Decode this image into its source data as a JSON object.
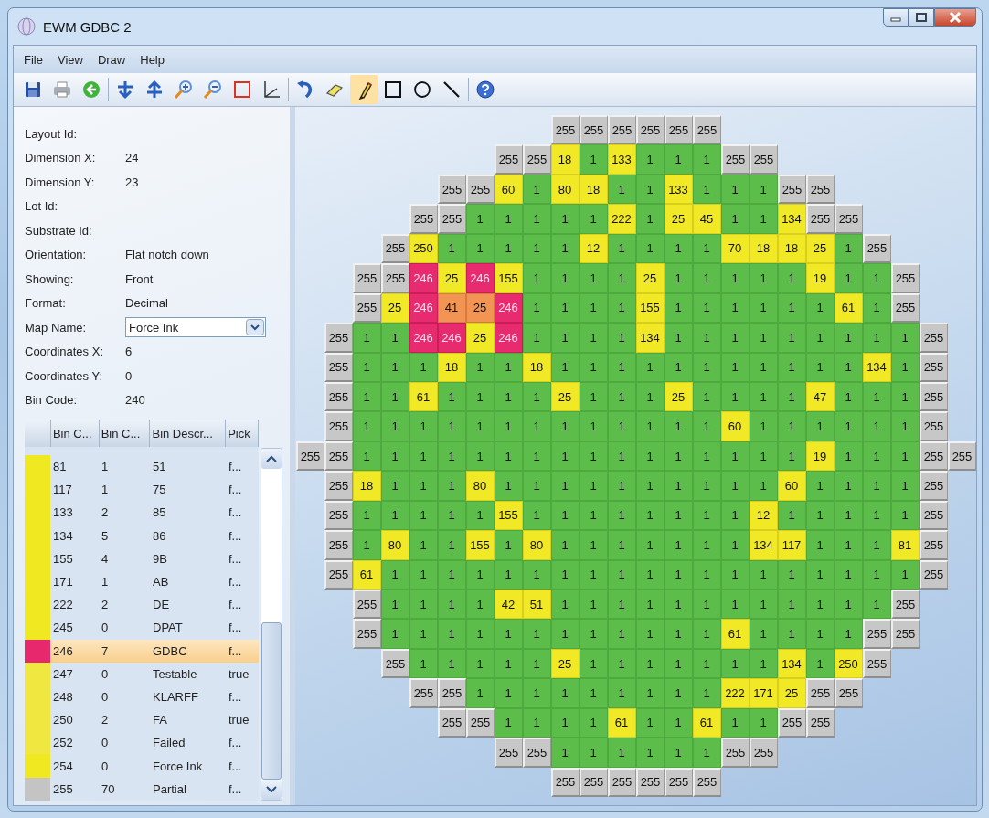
{
  "window": {
    "title": "EWM GDBC 2"
  },
  "menu": [
    "File",
    "View",
    "Draw",
    "Help"
  ],
  "toolbar": [
    {
      "kind": "save",
      "selected": false
    },
    {
      "kind": "print",
      "selected": false
    },
    {
      "kind": "back",
      "selected": false
    },
    {
      "kind": "separator"
    },
    {
      "kind": "flip-down",
      "selected": false
    },
    {
      "kind": "flip-up",
      "selected": false
    },
    {
      "kind": "zoom-in",
      "selected": false
    },
    {
      "kind": "zoom-out",
      "selected": false
    },
    {
      "kind": "frame",
      "selected": false
    },
    {
      "kind": "axes",
      "selected": false
    },
    {
      "kind": "separator"
    },
    {
      "kind": "undo",
      "selected": false
    },
    {
      "kind": "eraser",
      "selected": false
    },
    {
      "kind": "pencil",
      "selected": true
    },
    {
      "kind": "rectangle",
      "selected": false
    },
    {
      "kind": "circle",
      "selected": false
    },
    {
      "kind": "line",
      "selected": false
    },
    {
      "kind": "separator"
    },
    {
      "kind": "help",
      "selected": false
    }
  ],
  "properties": [
    {
      "kind": "text",
      "label": "Layout Id:"
    },
    {
      "kind": "text",
      "label": "Dimension X:",
      "value": "24"
    },
    {
      "kind": "text",
      "label": "Dimension Y:",
      "value": "23"
    },
    {
      "kind": "text",
      "label": "Lot Id:"
    },
    {
      "kind": "text",
      "label": "Substrate Id:"
    },
    {
      "kind": "text",
      "label": "Orientation:",
      "value": "Flat notch down"
    },
    {
      "kind": "text",
      "label": "Showing:",
      "value": "Front"
    },
    {
      "kind": "text",
      "label": "Format:",
      "value": "Decimal"
    },
    {
      "kind": "combo",
      "label": "Map Name:",
      "value": "Force Ink"
    },
    {
      "kind": "text",
      "label": "Coordinates X:",
      "value": "6"
    },
    {
      "kind": "text",
      "label": "Coordinates Y:",
      "value": "0"
    },
    {
      "kind": "text",
      "label": "Bin Code:",
      "value": "240"
    }
  ],
  "bin_table": {
    "columns": [
      "Bin C...",
      "Bin C...",
      "Bin Descr...",
      "Pick"
    ],
    "rows": [
      {
        "color": "#f0e820",
        "cells": [
          "81",
          "1",
          "51",
          "f..."
        ],
        "selected": false
      },
      {
        "color": "#f0e820",
        "cells": [
          "117",
          "1",
          "75",
          "f..."
        ],
        "selected": false
      },
      {
        "color": "#f0e820",
        "cells": [
          "133",
          "2",
          "85",
          "f..."
        ],
        "selected": false
      },
      {
        "color": "#f0e820",
        "cells": [
          "134",
          "5",
          "86",
          "f..."
        ],
        "selected": false
      },
      {
        "color": "#f0e820",
        "cells": [
          "155",
          "4",
          "9B",
          "f..."
        ],
        "selected": false
      },
      {
        "color": "#f0e820",
        "cells": [
          "171",
          "1",
          "AB",
          "f..."
        ],
        "selected": false
      },
      {
        "color": "#f0e820",
        "cells": [
          "222",
          "2",
          "DE",
          "f..."
        ],
        "selected": false
      },
      {
        "color": "#f0e820",
        "cells": [
          "245",
          "0",
          "DPAT",
          "f..."
        ],
        "selected": false
      },
      {
        "color": "#e8286c",
        "cells": [
          "246",
          "7",
          "GDBC",
          "f..."
        ],
        "selected": true
      },
      {
        "color": "#f0e840",
        "cells": [
          "247",
          "0",
          "Testable",
          "true"
        ],
        "selected": false
      },
      {
        "color": "#f0e840",
        "cells": [
          "248",
          "0",
          "KLARFF",
          "f..."
        ],
        "selected": false
      },
      {
        "color": "#f0e840",
        "cells": [
          "250",
          "2",
          "FA",
          "true"
        ],
        "selected": false
      },
      {
        "color": "#f0e840",
        "cells": [
          "252",
          "0",
          "Failed",
          "f..."
        ],
        "selected": false
      },
      {
        "color": "#f0e820",
        "cells": [
          "254",
          "0",
          "Force Ink",
          "f..."
        ],
        "selected": false
      },
      {
        "color": "#c4c4c4",
        "cells": [
          "255",
          "70",
          "Partial",
          "f..."
        ],
        "selected": false
      }
    ]
  },
  "wafer_map": {
    "rows": [
      [
        null,
        null,
        null,
        null,
        null,
        null,
        null,
        null,
        null,
        {
          "bin": "255",
          "kind": "edge"
        },
        {
          "bin": "255",
          "kind": "edge"
        },
        {
          "bin": "255",
          "kind": "edge"
        },
        {
          "bin": "255",
          "kind": "edge"
        },
        {
          "bin": "255",
          "kind": "edge"
        },
        {
          "bin": "255",
          "kind": "edge"
        },
        null,
        null,
        null,
        null,
        null,
        null,
        null,
        null,
        null
      ],
      [
        null,
        null,
        null,
        null,
        null,
        null,
        null,
        {
          "bin": "255",
          "kind": "edge"
        },
        {
          "bin": "255",
          "kind": "edge"
        },
        {
          "bin": "18",
          "kind": "fail"
        },
        {
          "bin": "1",
          "kind": "pass"
        },
        {
          "bin": "133",
          "kind": "fail"
        },
        {
          "bin": "1",
          "kind": "pass"
        },
        {
          "bin": "1",
          "kind": "pass"
        },
        {
          "bin": "1",
          "kind": "pass"
        },
        {
          "bin": "255",
          "kind": "edge"
        },
        {
          "bin": "255",
          "kind": "edge"
        },
        null,
        null,
        null,
        null,
        null,
        null,
        null
      ],
      [
        null,
        null,
        null,
        null,
        null,
        {
          "bin": "255",
          "kind": "edge"
        },
        {
          "bin": "255",
          "kind": "edge"
        },
        {
          "bin": "60",
          "kind": "fail"
        },
        {
          "bin": "1",
          "kind": "pass"
        },
        {
          "bin": "80",
          "kind": "fail"
        },
        {
          "bin": "18",
          "kind": "fail"
        },
        {
          "bin": "1",
          "kind": "pass"
        },
        {
          "bin": "1",
          "kind": "pass"
        },
        {
          "bin": "133",
          "kind": "fail"
        },
        {
          "bin": "1",
          "kind": "pass"
        },
        {
          "bin": "1",
          "kind": "pass"
        },
        {
          "bin": "1",
          "kind": "pass"
        },
        {
          "bin": "255",
          "kind": "edge"
        },
        {
          "bin": "255",
          "kind": "edge"
        },
        null,
        null,
        null,
        null,
        null
      ],
      [
        null,
        null,
        null,
        null,
        {
          "bin": "255",
          "kind": "edge"
        },
        {
          "bin": "255",
          "kind": "edge"
        },
        {
          "bin": "1",
          "kind": "pass"
        },
        {
          "bin": "1",
          "kind": "pass"
        },
        {
          "bin": "1",
          "kind": "pass"
        },
        {
          "bin": "1",
          "kind": "pass"
        },
        {
          "bin": "1",
          "kind": "pass"
        },
        {
          "bin": "222",
          "kind": "fail"
        },
        {
          "bin": "1",
          "kind": "pass"
        },
        {
          "bin": "25",
          "kind": "fail"
        },
        {
          "bin": "45",
          "kind": "fail"
        },
        {
          "bin": "1",
          "kind": "pass"
        },
        {
          "bin": "1",
          "kind": "pass"
        },
        {
          "bin": "134",
          "kind": "fail"
        },
        {
          "bin": "255",
          "kind": "edge"
        },
        {
          "bin": "255",
          "kind": "edge"
        },
        null,
        null,
        null,
        null
      ],
      [
        null,
        null,
        null,
        {
          "bin": "255",
          "kind": "edge"
        },
        {
          "bin": "250",
          "kind": "fail"
        },
        {
          "bin": "1",
          "kind": "pass"
        },
        {
          "bin": "1",
          "kind": "pass"
        },
        {
          "bin": "1",
          "kind": "pass"
        },
        {
          "bin": "1",
          "kind": "pass"
        },
        {
          "bin": "1",
          "kind": "pass"
        },
        {
          "bin": "12",
          "kind": "fail"
        },
        {
          "bin": "1",
          "kind": "pass"
        },
        {
          "bin": "1",
          "kind": "pass"
        },
        {
          "bin": "1",
          "kind": "pass"
        },
        {
          "bin": "1",
          "kind": "pass"
        },
        {
          "bin": "70",
          "kind": "fail"
        },
        {
          "bin": "18",
          "kind": "fail"
        },
        {
          "bin": "18",
          "kind": "fail"
        },
        {
          "bin": "25",
          "kind": "fail"
        },
        {
          "bin": "1",
          "kind": "pass"
        },
        {
          "bin": "255",
          "kind": "edge"
        },
        null,
        null,
        null
      ],
      [
        null,
        null,
        {
          "bin": "255",
          "kind": "edge"
        },
        {
          "bin": "255",
          "kind": "edge"
        },
        {
          "bin": "246",
          "kind": "gdbc"
        },
        {
          "bin": "25",
          "kind": "fail"
        },
        {
          "bin": "246",
          "kind": "gdbc"
        },
        {
          "bin": "155",
          "kind": "fail"
        },
        {
          "bin": "1",
          "kind": "pass"
        },
        {
          "bin": "1",
          "kind": "pass"
        },
        {
          "bin": "1",
          "kind": "pass"
        },
        {
          "bin": "1",
          "kind": "pass"
        },
        {
          "bin": "25",
          "kind": "fail"
        },
        {
          "bin": "1",
          "kind": "pass"
        },
        {
          "bin": "1",
          "kind": "pass"
        },
        {
          "bin": "1",
          "kind": "pass"
        },
        {
          "bin": "1",
          "kind": "pass"
        },
        {
          "bin": "1",
          "kind": "pass"
        },
        {
          "bin": "19",
          "kind": "fail"
        },
        {
          "bin": "1",
          "kind": "pass"
        },
        {
          "bin": "1",
          "kind": "pass"
        },
        {
          "bin": "255",
          "kind": "edge"
        },
        null,
        null
      ],
      [
        null,
        null,
        {
          "bin": "255",
          "kind": "edge"
        },
        {
          "bin": "25",
          "kind": "fail"
        },
        {
          "bin": "246",
          "kind": "gdbc"
        },
        {
          "bin": "41",
          "kind": "near"
        },
        {
          "bin": "25",
          "kind": "near"
        },
        {
          "bin": "246",
          "kind": "gdbc"
        },
        {
          "bin": "1",
          "kind": "pass"
        },
        {
          "bin": "1",
          "kind": "pass"
        },
        {
          "bin": "1",
          "kind": "pass"
        },
        {
          "bin": "1",
          "kind": "pass"
        },
        {
          "bin": "155",
          "kind": "fail"
        },
        {
          "bin": "1",
          "kind": "pass"
        },
        {
          "bin": "1",
          "kind": "pass"
        },
        {
          "bin": "1",
          "kind": "pass"
        },
        {
          "bin": "1",
          "kind": "pass"
        },
        {
          "bin": "1",
          "kind": "pass"
        },
        {
          "bin": "1",
          "kind": "pass"
        },
        {
          "bin": "61",
          "kind": "fail"
        },
        {
          "bin": "1",
          "kind": "pass"
        },
        {
          "bin": "255",
          "kind": "edge"
        },
        null,
        null
      ],
      [
        null,
        {
          "bin": "255",
          "kind": "edge"
        },
        {
          "bin": "1",
          "kind": "pass"
        },
        {
          "bin": "1",
          "kind": "pass"
        },
        {
          "bin": "246",
          "kind": "gdbc"
        },
        {
          "bin": "246",
          "kind": "gdbc"
        },
        {
          "bin": "25",
          "kind": "fail"
        },
        {
          "bin": "246",
          "kind": "gdbc"
        },
        {
          "bin": "1",
          "kind": "pass"
        },
        {
          "bin": "1",
          "kind": "pass"
        },
        {
          "bin": "1",
          "kind": "pass"
        },
        {
          "bin": "1",
          "kind": "pass"
        },
        {
          "bin": "134",
          "kind": "fail"
        },
        {
          "bin": "1",
          "kind": "pass"
        },
        {
          "bin": "1",
          "kind": "pass"
        },
        {
          "bin": "1",
          "kind": "pass"
        },
        {
          "bin": "1",
          "kind": "pass"
        },
        {
          "bin": "1",
          "kind": "pass"
        },
        {
          "bin": "1",
          "kind": "pass"
        },
        {
          "bin": "1",
          "kind": "pass"
        },
        {
          "bin": "1",
          "kind": "pass"
        },
        {
          "bin": "1",
          "kind": "pass"
        },
        {
          "bin": "255",
          "kind": "edge"
        },
        null
      ],
      [
        null,
        {
          "bin": "255",
          "kind": "edge"
        },
        {
          "bin": "1",
          "kind": "pass"
        },
        {
          "bin": "1",
          "kind": "pass"
        },
        {
          "bin": "1",
          "kind": "pass"
        },
        {
          "bin": "18",
          "kind": "fail"
        },
        {
          "bin": "1",
          "kind": "pass"
        },
        {
          "bin": "1",
          "kind": "pass"
        },
        {
          "bin": "18",
          "kind": "fail"
        },
        {
          "bin": "1",
          "kind": "pass"
        },
        {
          "bin": "1",
          "kind": "pass"
        },
        {
          "bin": "1",
          "kind": "pass"
        },
        {
          "bin": "1",
          "kind": "pass"
        },
        {
          "bin": "1",
          "kind": "pass"
        },
        {
          "bin": "1",
          "kind": "pass"
        },
        {
          "bin": "1",
          "kind": "pass"
        },
        {
          "bin": "1",
          "kind": "pass"
        },
        {
          "bin": "1",
          "kind": "pass"
        },
        {
          "bin": "1",
          "kind": "pass"
        },
        {
          "bin": "1",
          "kind": "pass"
        },
        {
          "bin": "134",
          "kind": "fail"
        },
        {
          "bin": "1",
          "kind": "pass"
        },
        {
          "bin": "255",
          "kind": "edge"
        },
        null
      ],
      [
        null,
        {
          "bin": "255",
          "kind": "edge"
        },
        {
          "bin": "1",
          "kind": "pass"
        },
        {
          "bin": "1",
          "kind": "pass"
        },
        {
          "bin": "61",
          "kind": "fail"
        },
        {
          "bin": "1",
          "kind": "pass"
        },
        {
          "bin": "1",
          "kind": "pass"
        },
        {
          "bin": "1",
          "kind": "pass"
        },
        {
          "bin": "1",
          "kind": "pass"
        },
        {
          "bin": "25",
          "kind": "fail"
        },
        {
          "bin": "1",
          "kind": "pass"
        },
        {
          "bin": "1",
          "kind": "pass"
        },
        {
          "bin": "1",
          "kind": "pass"
        },
        {
          "bin": "25",
          "kind": "fail"
        },
        {
          "bin": "1",
          "kind": "pass"
        },
        {
          "bin": "1",
          "kind": "pass"
        },
        {
          "bin": "1",
          "kind": "pass"
        },
        {
          "bin": "1",
          "kind": "pass"
        },
        {
          "bin": "47",
          "kind": "fail"
        },
        {
          "bin": "1",
          "kind": "pass"
        },
        {
          "bin": "1",
          "kind": "pass"
        },
        {
          "bin": "1",
          "kind": "pass"
        },
        {
          "bin": "255",
          "kind": "edge"
        },
        null
      ],
      [
        null,
        {
          "bin": "255",
          "kind": "edge"
        },
        {
          "bin": "1",
          "kind": "pass"
        },
        {
          "bin": "1",
          "kind": "pass"
        },
        {
          "bin": "1",
          "kind": "pass"
        },
        {
          "bin": "1",
          "kind": "pass"
        },
        {
          "bin": "1",
          "kind": "pass"
        },
        {
          "bin": "1",
          "kind": "pass"
        },
        {
          "bin": "1",
          "kind": "pass"
        },
        {
          "bin": "1",
          "kind": "pass"
        },
        {
          "bin": "1",
          "kind": "pass"
        },
        {
          "bin": "1",
          "kind": "pass"
        },
        {
          "bin": "1",
          "kind": "pass"
        },
        {
          "bin": "1",
          "kind": "pass"
        },
        {
          "bin": "1",
          "kind": "pass"
        },
        {
          "bin": "60",
          "kind": "fail"
        },
        {
          "bin": "1",
          "kind": "pass"
        },
        {
          "bin": "1",
          "kind": "pass"
        },
        {
          "bin": "1",
          "kind": "pass"
        },
        {
          "bin": "1",
          "kind": "pass"
        },
        {
          "bin": "1",
          "kind": "pass"
        },
        {
          "bin": "1",
          "kind": "pass"
        },
        {
          "bin": "255",
          "kind": "edge"
        },
        null
      ],
      [
        {
          "bin": "255",
          "kind": "edge"
        },
        {
          "bin": "255",
          "kind": "edge"
        },
        {
          "bin": "1",
          "kind": "pass"
        },
        {
          "bin": "1",
          "kind": "pass"
        },
        {
          "bin": "1",
          "kind": "pass"
        },
        {
          "bin": "1",
          "kind": "pass"
        },
        {
          "bin": "1",
          "kind": "pass"
        },
        {
          "bin": "1",
          "kind": "pass"
        },
        {
          "bin": "1",
          "kind": "pass"
        },
        {
          "bin": "1",
          "kind": "pass"
        },
        {
          "bin": "1",
          "kind": "pass"
        },
        {
          "bin": "1",
          "kind": "pass"
        },
        {
          "bin": "1",
          "kind": "pass"
        },
        {
          "bin": "1",
          "kind": "pass"
        },
        {
          "bin": "1",
          "kind": "pass"
        },
        {
          "bin": "1",
          "kind": "pass"
        },
        {
          "bin": "1",
          "kind": "pass"
        },
        {
          "bin": "1",
          "kind": "pass"
        },
        {
          "bin": "19",
          "kind": "fail"
        },
        {
          "bin": "1",
          "kind": "pass"
        },
        {
          "bin": "1",
          "kind": "pass"
        },
        {
          "bin": "1",
          "kind": "pass"
        },
        {
          "bin": "255",
          "kind": "edge"
        },
        {
          "bin": "255",
          "kind": "edge"
        }
      ],
      [
        null,
        {
          "bin": "255",
          "kind": "edge"
        },
        {
          "bin": "18",
          "kind": "fail"
        },
        {
          "bin": "1",
          "kind": "pass"
        },
        {
          "bin": "1",
          "kind": "pass"
        },
        {
          "bin": "1",
          "kind": "pass"
        },
        {
          "bin": "80",
          "kind": "fail"
        },
        {
          "bin": "1",
          "kind": "pass"
        },
        {
          "bin": "1",
          "kind": "pass"
        },
        {
          "bin": "1",
          "kind": "pass"
        },
        {
          "bin": "1",
          "kind": "pass"
        },
        {
          "bin": "1",
          "kind": "pass"
        },
        {
          "bin": "1",
          "kind": "pass"
        },
        {
          "bin": "1",
          "kind": "pass"
        },
        {
          "bin": "1",
          "kind": "pass"
        },
        {
          "bin": "1",
          "kind": "pass"
        },
        {
          "bin": "1",
          "kind": "pass"
        },
        {
          "bin": "60",
          "kind": "fail"
        },
        {
          "bin": "1",
          "kind": "pass"
        },
        {
          "bin": "1",
          "kind": "pass"
        },
        {
          "bin": "1",
          "kind": "pass"
        },
        {
          "bin": "1",
          "kind": "pass"
        },
        {
          "bin": "255",
          "kind": "edge"
        },
        null
      ],
      [
        null,
        {
          "bin": "255",
          "kind": "edge"
        },
        {
          "bin": "1",
          "kind": "pass"
        },
        {
          "bin": "1",
          "kind": "pass"
        },
        {
          "bin": "1",
          "kind": "pass"
        },
        {
          "bin": "1",
          "kind": "pass"
        },
        {
          "bin": "1",
          "kind": "pass"
        },
        {
          "bin": "155",
          "kind": "fail"
        },
        {
          "bin": "1",
          "kind": "pass"
        },
        {
          "bin": "1",
          "kind": "pass"
        },
        {
          "bin": "1",
          "kind": "pass"
        },
        {
          "bin": "1",
          "kind": "pass"
        },
        {
          "bin": "1",
          "kind": "pass"
        },
        {
          "bin": "1",
          "kind": "pass"
        },
        {
          "bin": "1",
          "kind": "pass"
        },
        {
          "bin": "1",
          "kind": "pass"
        },
        {
          "bin": "12",
          "kind": "fail"
        },
        {
          "bin": "1",
          "kind": "pass"
        },
        {
          "bin": "1",
          "kind": "pass"
        },
        {
          "bin": "1",
          "kind": "pass"
        },
        {
          "bin": "1",
          "kind": "pass"
        },
        {
          "bin": "1",
          "kind": "pass"
        },
        {
          "bin": "255",
          "kind": "edge"
        },
        null
      ],
      [
        null,
        {
          "bin": "255",
          "kind": "edge"
        },
        {
          "bin": "1",
          "kind": "pass"
        },
        {
          "bin": "80",
          "kind": "fail"
        },
        {
          "bin": "1",
          "kind": "pass"
        },
        {
          "bin": "1",
          "kind": "pass"
        },
        {
          "bin": "155",
          "kind": "fail"
        },
        {
          "bin": "1",
          "kind": "pass"
        },
        {
          "bin": "80",
          "kind": "fail"
        },
        {
          "bin": "1",
          "kind": "pass"
        },
        {
          "bin": "1",
          "kind": "pass"
        },
        {
          "bin": "1",
          "kind": "pass"
        },
        {
          "bin": "1",
          "kind": "pass"
        },
        {
          "bin": "1",
          "kind": "pass"
        },
        {
          "bin": "1",
          "kind": "pass"
        },
        {
          "bin": "1",
          "kind": "pass"
        },
        {
          "bin": "134",
          "kind": "fail"
        },
        {
          "bin": "117",
          "kind": "fail"
        },
        {
          "bin": "1",
          "kind": "pass"
        },
        {
          "bin": "1",
          "kind": "pass"
        },
        {
          "bin": "1",
          "kind": "pass"
        },
        {
          "bin": "81",
          "kind": "fail"
        },
        {
          "bin": "255",
          "kind": "edge"
        },
        null
      ],
      [
        null,
        {
          "bin": "255",
          "kind": "edge"
        },
        {
          "bin": "61",
          "kind": "fail"
        },
        {
          "bin": "1",
          "kind": "pass"
        },
        {
          "bin": "1",
          "kind": "pass"
        },
        {
          "bin": "1",
          "kind": "pass"
        },
        {
          "bin": "1",
          "kind": "pass"
        },
        {
          "bin": "1",
          "kind": "pass"
        },
        {
          "bin": "1",
          "kind": "pass"
        },
        {
          "bin": "1",
          "kind": "pass"
        },
        {
          "bin": "1",
          "kind": "pass"
        },
        {
          "bin": "1",
          "kind": "pass"
        },
        {
          "bin": "1",
          "kind": "pass"
        },
        {
          "bin": "1",
          "kind": "pass"
        },
        {
          "bin": "1",
          "kind": "pass"
        },
        {
          "bin": "1",
          "kind": "pass"
        },
        {
          "bin": "1",
          "kind": "pass"
        },
        {
          "bin": "1",
          "kind": "pass"
        },
        {
          "bin": "1",
          "kind": "pass"
        },
        {
          "bin": "1",
          "kind": "pass"
        },
        {
          "bin": "1",
          "kind": "pass"
        },
        {
          "bin": "1",
          "kind": "pass"
        },
        {
          "bin": "255",
          "kind": "edge"
        },
        null
      ],
      [
        null,
        null,
        {
          "bin": "255",
          "kind": "edge"
        },
        {
          "bin": "1",
          "kind": "pass"
        },
        {
          "bin": "1",
          "kind": "pass"
        },
        {
          "bin": "1",
          "kind": "pass"
        },
        {
          "bin": "1",
          "kind": "pass"
        },
        {
          "bin": "42",
          "kind": "fail"
        },
        {
          "bin": "51",
          "kind": "fail"
        },
        {
          "bin": "1",
          "kind": "pass"
        },
        {
          "bin": "1",
          "kind": "pass"
        },
        {
          "bin": "1",
          "kind": "pass"
        },
        {
          "bin": "1",
          "kind": "pass"
        },
        {
          "bin": "1",
          "kind": "pass"
        },
        {
          "bin": "1",
          "kind": "pass"
        },
        {
          "bin": "1",
          "kind": "pass"
        },
        {
          "bin": "1",
          "kind": "pass"
        },
        {
          "bin": "1",
          "kind": "pass"
        },
        {
          "bin": "1",
          "kind": "pass"
        },
        {
          "bin": "1",
          "kind": "pass"
        },
        {
          "bin": "1",
          "kind": "pass"
        },
        {
          "bin": "255",
          "kind": "edge"
        },
        null,
        null
      ],
      [
        null,
        null,
        {
          "bin": "255",
          "kind": "edge"
        },
        {
          "bin": "1",
          "kind": "pass"
        },
        {
          "bin": "1",
          "kind": "pass"
        },
        {
          "bin": "1",
          "kind": "pass"
        },
        {
          "bin": "1",
          "kind": "pass"
        },
        {
          "bin": "1",
          "kind": "pass"
        },
        {
          "bin": "1",
          "kind": "pass"
        },
        {
          "bin": "1",
          "kind": "pass"
        },
        {
          "bin": "1",
          "kind": "pass"
        },
        {
          "bin": "1",
          "kind": "pass"
        },
        {
          "bin": "1",
          "kind": "pass"
        },
        {
          "bin": "1",
          "kind": "pass"
        },
        {
          "bin": "1",
          "kind": "pass"
        },
        {
          "bin": "61",
          "kind": "fail"
        },
        {
          "bin": "1",
          "kind": "pass"
        },
        {
          "bin": "1",
          "kind": "pass"
        },
        {
          "bin": "1",
          "kind": "pass"
        },
        {
          "bin": "1",
          "kind": "pass"
        },
        {
          "bin": "255",
          "kind": "edge"
        },
        {
          "bin": "255",
          "kind": "edge"
        },
        null,
        null
      ],
      [
        null,
        null,
        null,
        {
          "bin": "255",
          "kind": "edge"
        },
        {
          "bin": "1",
          "kind": "pass"
        },
        {
          "bin": "1",
          "kind": "pass"
        },
        {
          "bin": "1",
          "kind": "pass"
        },
        {
          "bin": "1",
          "kind": "pass"
        },
        {
          "bin": "1",
          "kind": "pass"
        },
        {
          "bin": "25",
          "kind": "fail"
        },
        {
          "bin": "1",
          "kind": "pass"
        },
        {
          "bin": "1",
          "kind": "pass"
        },
        {
          "bin": "1",
          "kind": "pass"
        },
        {
          "bin": "1",
          "kind": "pass"
        },
        {
          "bin": "1",
          "kind": "pass"
        },
        {
          "bin": "1",
          "kind": "pass"
        },
        {
          "bin": "1",
          "kind": "pass"
        },
        {
          "bin": "134",
          "kind": "fail"
        },
        {
          "bin": "1",
          "kind": "pass"
        },
        {
          "bin": "250",
          "kind": "fail"
        },
        {
          "bin": "255",
          "kind": "edge"
        },
        null,
        null,
        null
      ],
      [
        null,
        null,
        null,
        null,
        {
          "bin": "255",
          "kind": "edge"
        },
        {
          "bin": "255",
          "kind": "edge"
        },
        {
          "bin": "1",
          "kind": "pass"
        },
        {
          "bin": "1",
          "kind": "pass"
        },
        {
          "bin": "1",
          "kind": "pass"
        },
        {
          "bin": "1",
          "kind": "pass"
        },
        {
          "bin": "1",
          "kind": "pass"
        },
        {
          "bin": "1",
          "kind": "pass"
        },
        {
          "bin": "1",
          "kind": "pass"
        },
        {
          "bin": "1",
          "kind": "pass"
        },
        {
          "bin": "1",
          "kind": "pass"
        },
        {
          "bin": "222",
          "kind": "fail"
        },
        {
          "bin": "171",
          "kind": "fail"
        },
        {
          "bin": "25",
          "kind": "fail"
        },
        {
          "bin": "255",
          "kind": "edge"
        },
        {
          "bin": "255",
          "kind": "edge"
        },
        null,
        null,
        null,
        null
      ],
      [
        null,
        null,
        null,
        null,
        null,
        {
          "bin": "255",
          "kind": "edge"
        },
        {
          "bin": "255",
          "kind": "edge"
        },
        {
          "bin": "1",
          "kind": "pass"
        },
        {
          "bin": "1",
          "kind": "pass"
        },
        {
          "bin": "1",
          "kind": "pass"
        },
        {
          "bin": "1",
          "kind": "pass"
        },
        {
          "bin": "61",
          "kind": "fail"
        },
        {
          "bin": "1",
          "kind": "pass"
        },
        {
          "bin": "1",
          "kind": "pass"
        },
        {
          "bin": "61",
          "kind": "fail"
        },
        {
          "bin": "1",
          "kind": "pass"
        },
        {
          "bin": "1",
          "kind": "pass"
        },
        {
          "bin": "255",
          "kind": "edge"
        },
        {
          "bin": "255",
          "kind": "edge"
        },
        null,
        null,
        null,
        null,
        null
      ],
      [
        null,
        null,
        null,
        null,
        null,
        null,
        null,
        {
          "bin": "255",
          "kind": "edge"
        },
        {
          "bin": "255",
          "kind": "edge"
        },
        {
          "bin": "1",
          "kind": "pass"
        },
        {
          "bin": "1",
          "kind": "pass"
        },
        {
          "bin": "1",
          "kind": "pass"
        },
        {
          "bin": "1",
          "kind": "pass"
        },
        {
          "bin": "1",
          "kind": "pass"
        },
        {
          "bin": "1",
          "kind": "pass"
        },
        {
          "bin": "255",
          "kind": "edge"
        },
        {
          "bin": "255",
          "kind": "edge"
        },
        null,
        null,
        null,
        null,
        null,
        null,
        null
      ],
      [
        null,
        null,
        null,
        null,
        null,
        null,
        null,
        null,
        null,
        {
          "bin": "255",
          "kind": "edge"
        },
        {
          "bin": "255",
          "kind": "edge"
        },
        {
          "bin": "255",
          "kind": "edge"
        },
        {
          "bin": "255",
          "kind": "edge"
        },
        {
          "bin": "255",
          "kind": "edge"
        },
        {
          "bin": "255",
          "kind": "edge"
        },
        null,
        null,
        null,
        null,
        null,
        null,
        null,
        null,
        null
      ]
    ]
  }
}
